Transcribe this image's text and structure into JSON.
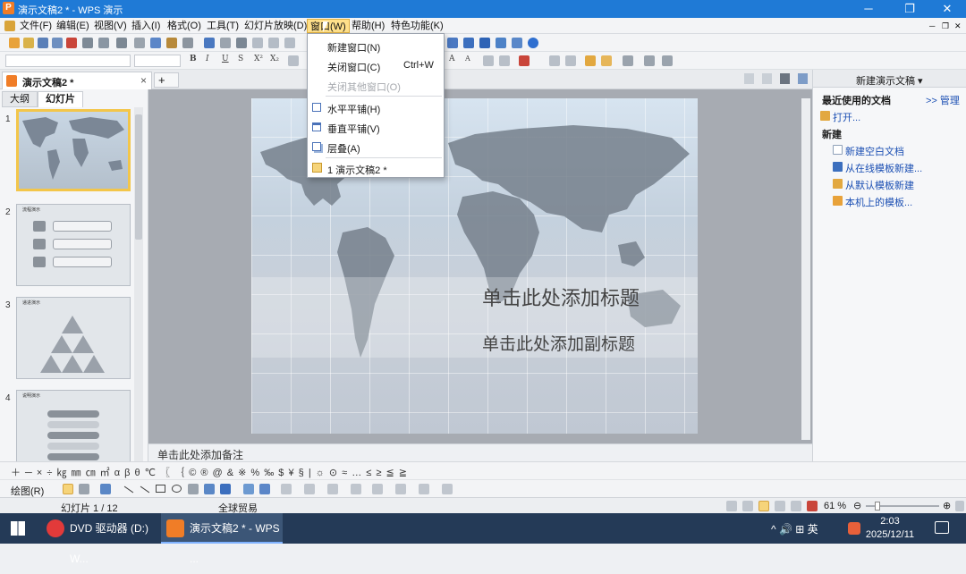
{
  "app": {
    "title": "演示文稿2 * - WPS 演示",
    "icon_letter": "P",
    "window_controls": {
      "minimize": "─",
      "maximize": "❐",
      "close": "✕"
    }
  },
  "menu": {
    "items": [
      "文件(F)",
      "编辑(E)",
      "视图(V)",
      "插入(I)",
      "格式(O)",
      "工具(T)",
      "幻灯片放映(D)",
      "窗口(W)",
      "帮助(H)",
      "特色功能(K)"
    ],
    "active": "窗口(W)",
    "doc_controls": {
      "minimize": "─",
      "maximize": "❐",
      "close": "✕"
    }
  },
  "toolbar2_glyphs": [
    "B",
    "I",
    "U",
    "S",
    "X²",
    "X₂",
    "A",
    "A"
  ],
  "doc_tabs": {
    "active": "演示文稿2 *",
    "close": "×",
    "new_tab": "+"
  },
  "left_panel": {
    "tabs": [
      "大纲",
      "幻灯片"
    ],
    "active_tab": "幻灯片",
    "slides": [
      {
        "num": "1",
        "title": ""
      },
      {
        "num": "2",
        "title": "流程演示"
      },
      {
        "num": "3",
        "title": "递进演示"
      },
      {
        "num": "4",
        "title": "说明演示"
      }
    ]
  },
  "slide": {
    "title_placeholder": "单击此处添加标题",
    "subtitle_placeholder": "单击此处添加副标题"
  },
  "notes_placeholder": "单击此处添加备注",
  "window_menu": {
    "items": [
      {
        "label": "新建窗口(N)",
        "shortcut": "",
        "disabled": false,
        "icon": "none"
      },
      {
        "label": "关闭窗口(C)",
        "shortcut": "Ctrl+W",
        "disabled": false,
        "icon": "none"
      },
      {
        "label": "关闭其他窗口(O)",
        "shortcut": "",
        "disabled": true,
        "icon": "none"
      },
      {
        "label": "水平平铺(H)",
        "shortcut": "",
        "disabled": false,
        "icon": "tile-horizontal-icon"
      },
      {
        "label": "垂直平铺(V)",
        "shortcut": "",
        "disabled": false,
        "icon": "tile-vertical-icon"
      },
      {
        "label": "层叠(A)",
        "shortcut": "",
        "disabled": false,
        "icon": "cascade-icon"
      },
      {
        "label": "1 演示文稿2 *",
        "shortcut": "",
        "disabled": false,
        "icon": "check-icon"
      }
    ]
  },
  "task_pane": {
    "title": "新建演示文稿 ▾",
    "recent_label": "最近使用的文档",
    "manage": ">> 管理",
    "open": "打开...",
    "new_label": "新建",
    "new_links": [
      "新建空白文档",
      "从在线模板新建...",
      "从默认模板新建",
      "本机上的模板..."
    ]
  },
  "symbol_bar": "＋ ─ × ÷ ㎏ ㎜ ㎝ ㎡ α β θ ℃ 〖 ｛ © ® @ & ※ % ‰ $ ¥ § | ☼ ⊙ ≈ … ≤ ≥ ≦ ≧",
  "draw_label": "绘图(R)",
  "status": {
    "slide": "幻灯片 1 / 12",
    "template": "全球贸易",
    "zoom": "61 %",
    "zoom_level": 0.61
  },
  "taskbar": {
    "apps": [
      "DVD 驱动器 (D:) W...",
      "演示文稿2 * - WPS ..."
    ],
    "tray": "^ 🔊 ⊞ 英",
    "time": "2:03",
    "date": "2025/12/11"
  },
  "colors": {
    "title_bar": "#1f7ad6",
    "taskbar": "#243a57",
    "menu_highlight": "#ffe08a",
    "wps_orange": "#f07d27"
  }
}
